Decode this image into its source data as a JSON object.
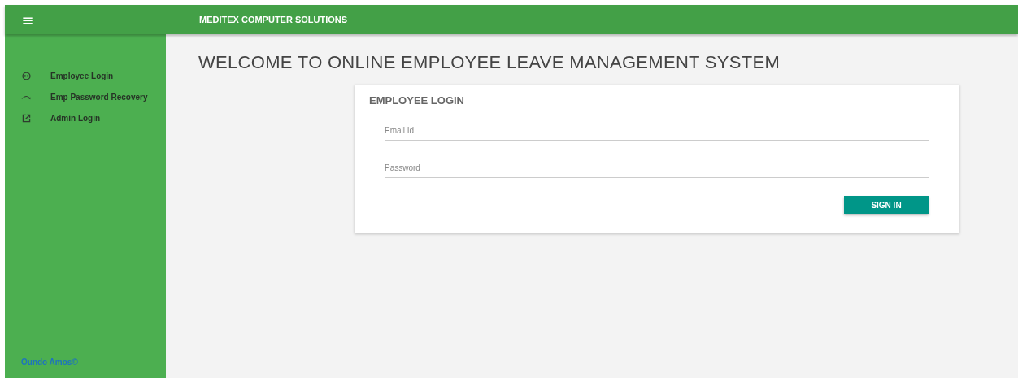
{
  "app_bar": {
    "menu_icon": "≡",
    "title": "MEDITEX COMPUTER SOLUTIONS"
  },
  "sidebar": {
    "items": [
      {
        "kind": "face",
        "label": "Employee Login"
      },
      {
        "kind": "redo",
        "label": "Emp Password Recovery"
      },
      {
        "kind": "launch",
        "label": "Admin Login"
      }
    ],
    "footer": "Oundo Amos©"
  },
  "heading": "WELCOME TO ONLINE EMPLOYEE LEAVE MANAGEMENT SYSTEM",
  "login_card": {
    "title": "EMPLOYEE LOGIN",
    "fields": [
      {
        "placeholder": "Email Id"
      },
      {
        "placeholder": "Password"
      }
    ],
    "button": "SIGN IN"
  }
}
